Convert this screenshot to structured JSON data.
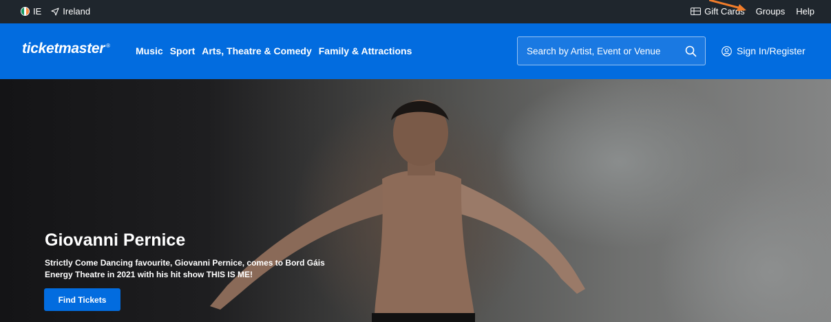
{
  "topbar": {
    "country_code": "IE",
    "location": "Ireland",
    "links": [
      "Gift Cards",
      "Groups",
      "Help"
    ]
  },
  "header": {
    "logo": "ticketmaster",
    "logo_mark": "®",
    "nav": [
      "Music",
      "Sport",
      "Arts, Theatre & Comedy",
      "Family & Attractions"
    ],
    "search_placeholder": "Search by Artist, Event or Venue",
    "signin": "Sign In/Register"
  },
  "hero": {
    "title": "Giovanni Pernice",
    "description": "Strictly Come Dancing favourite, Giovanni Pernice, comes to Bord Gáis Energy Theatre in 2021 with his hit show THIS IS ME!",
    "button": "Find Tickets"
  },
  "colors": {
    "brand_blue": "#026cdf",
    "topbar_bg": "#1f262d",
    "annotation_arrow": "#f07c2a",
    "flag_green": "#169b62",
    "flag_orange": "#ff883e"
  },
  "icons": [
    "flag-icon",
    "location-arrow-icon",
    "gift-card-icon",
    "search-icon",
    "user-icon"
  ]
}
